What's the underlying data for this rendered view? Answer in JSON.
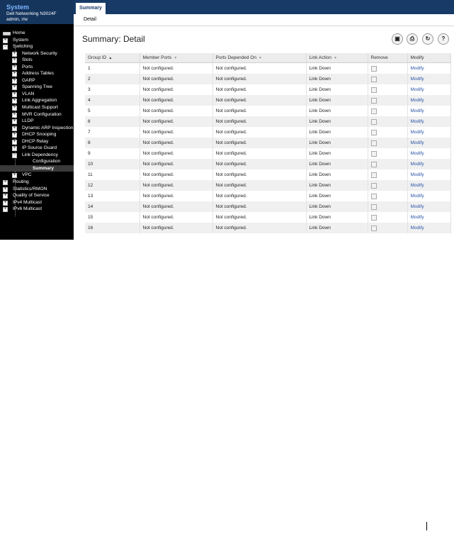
{
  "sidebar": {
    "title": "System",
    "device": "Dell Networking N3024F",
    "user": "admin, r/w",
    "items": [
      {
        "label": "Home",
        "level": 0,
        "toggle": "",
        "selected": false
      },
      {
        "label": "System",
        "level": 0,
        "toggle": "+",
        "selected": false
      },
      {
        "label": "Switching",
        "level": 0,
        "toggle": "−",
        "selected": false
      },
      {
        "label": "Network Security",
        "level": 1,
        "toggle": "+",
        "selected": false
      },
      {
        "label": "Slots",
        "level": 1,
        "toggle": "+",
        "selected": false
      },
      {
        "label": "Ports",
        "level": 1,
        "toggle": "+",
        "selected": false
      },
      {
        "label": "Address Tables",
        "level": 1,
        "toggle": "+",
        "selected": false
      },
      {
        "label": "GARP",
        "level": 1,
        "toggle": "+",
        "selected": false
      },
      {
        "label": "Spanning Tree",
        "level": 1,
        "toggle": "+",
        "selected": false
      },
      {
        "label": "VLAN",
        "level": 1,
        "toggle": "+",
        "selected": false
      },
      {
        "label": "Link Aggregation",
        "level": 1,
        "toggle": "+",
        "selected": false
      },
      {
        "label": "Multicast Support",
        "level": 1,
        "toggle": "+",
        "selected": false
      },
      {
        "label": "MVR Configuration",
        "level": 1,
        "toggle": "+",
        "selected": false
      },
      {
        "label": "LLDP",
        "level": 1,
        "toggle": "+",
        "selected": false
      },
      {
        "label": "Dynamic ARP Inspection",
        "level": 1,
        "toggle": "+",
        "selected": false
      },
      {
        "label": "DHCP Snooping",
        "level": 1,
        "toggle": "+",
        "selected": false
      },
      {
        "label": "DHCP Relay",
        "level": 1,
        "toggle": "+",
        "selected": false
      },
      {
        "label": "IP Source Guard",
        "level": 1,
        "toggle": "+",
        "selected": false
      },
      {
        "label": "Link Dependency",
        "level": 1,
        "toggle": "−",
        "selected": false
      },
      {
        "label": "Configuration",
        "level": 2,
        "toggle": "",
        "selected": false
      },
      {
        "label": "Summary",
        "level": 2,
        "toggle": "",
        "selected": true
      },
      {
        "label": "VPC",
        "level": 1,
        "toggle": "+",
        "selected": false
      },
      {
        "label": "Routing",
        "level": 0,
        "toggle": "+",
        "selected": false
      },
      {
        "label": "Statistics/RMON",
        "level": 0,
        "toggle": "+",
        "selected": false
      },
      {
        "label": "Quality of Service",
        "level": 0,
        "toggle": "+",
        "selected": false
      },
      {
        "label": "IPv4 Multicast",
        "level": 0,
        "toggle": "+",
        "selected": false
      },
      {
        "label": "IPv6 Multicast",
        "level": 0,
        "toggle": "+",
        "selected": false
      }
    ]
  },
  "tabs": {
    "active": "Summary",
    "sub": "Detail"
  },
  "page": {
    "title": "Summary: Detail"
  },
  "toolbar": {
    "buttons": [
      {
        "name": "save-icon",
        "glyph": "▣"
      },
      {
        "name": "print-icon",
        "glyph": "⎙"
      },
      {
        "name": "refresh-icon",
        "glyph": "↻"
      },
      {
        "name": "help-icon",
        "glyph": "?"
      }
    ]
  },
  "table": {
    "columns": [
      "Group ID",
      "Member Ports",
      "Ports Depended On",
      "Link Action",
      "Remove",
      "Modify"
    ],
    "sort_column": "Group ID",
    "rows": [
      {
        "id": "1",
        "member": "Not configured.",
        "depended": "Not configured.",
        "action": "Link Down",
        "modify": "Modify"
      },
      {
        "id": "2",
        "member": "Not configured.",
        "depended": "Not configured.",
        "action": "Link Down",
        "modify": "Modify"
      },
      {
        "id": "3",
        "member": "Not configured.",
        "depended": "Not configured.",
        "action": "Link Down",
        "modify": "Modify"
      },
      {
        "id": "4",
        "member": "Not configured.",
        "depended": "Not configured.",
        "action": "Link Down",
        "modify": "Modify"
      },
      {
        "id": "5",
        "member": "Not configured.",
        "depended": "Not configured.",
        "action": "Link Down",
        "modify": "Modify"
      },
      {
        "id": "6",
        "member": "Not configured.",
        "depended": "Not configured.",
        "action": "Link Down",
        "modify": "Modify"
      },
      {
        "id": "7",
        "member": "Not configured.",
        "depended": "Not configured.",
        "action": "Link Down",
        "modify": "Modify"
      },
      {
        "id": "8",
        "member": "Not configured.",
        "depended": "Not configured.",
        "action": "Link Down",
        "modify": "Modify"
      },
      {
        "id": "9",
        "member": "Not configured.",
        "depended": "Not configured.",
        "action": "Link Down",
        "modify": "Modify"
      },
      {
        "id": "10",
        "member": "Not configured.",
        "depended": "Not configured.",
        "action": "Link Down",
        "modify": "Modify"
      },
      {
        "id": "11",
        "member": "Not configured.",
        "depended": "Not configured.",
        "action": "Link Down",
        "modify": "Modify"
      },
      {
        "id": "12",
        "member": "Not configured.",
        "depended": "Not configured.",
        "action": "Link Down",
        "modify": "Modify"
      },
      {
        "id": "13",
        "member": "Not configured.",
        "depended": "Not configured.",
        "action": "Link Down",
        "modify": "Modify"
      },
      {
        "id": "14",
        "member": "Not configured.",
        "depended": "Not configured.",
        "action": "Link Down",
        "modify": "Modify"
      },
      {
        "id": "15",
        "member": "Not configured.",
        "depended": "Not configured.",
        "action": "Link Down",
        "modify": "Modify"
      },
      {
        "id": "16",
        "member": "Not configured.",
        "depended": "Not configured.",
        "action": "Link Down",
        "modify": "Modify"
      }
    ]
  },
  "colors": {
    "nav_bg": "#000000",
    "header_bg": "#15355d",
    "tabbar_bg": "#173a66",
    "link": "#2a55a8"
  }
}
